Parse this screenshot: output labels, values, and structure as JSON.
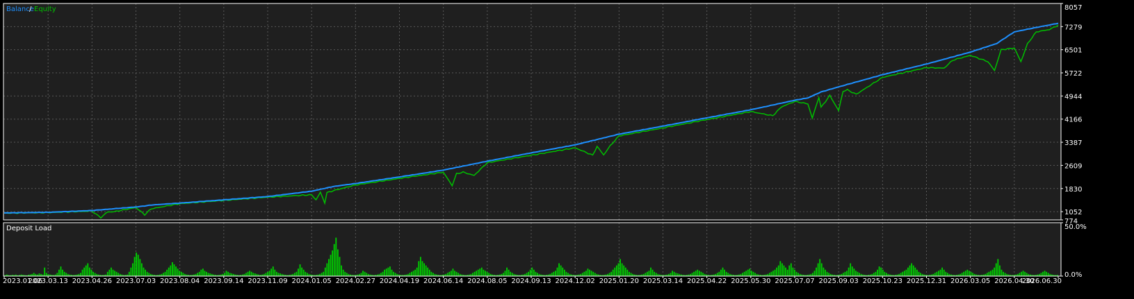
{
  "colors": {
    "background": "#000000",
    "plot_background": "#1f1f1f",
    "grid": "#5a5a5a",
    "frame": "#ffffff",
    "text": "#ffffff",
    "balance": "#1e90ff",
    "equity": "#00c000",
    "deposit_load": "#00d000"
  },
  "legend": {
    "balance": "Balance",
    "separator": "/",
    "equity": "Equity"
  },
  "lower_panel": {
    "title": "Deposit Load"
  },
  "chart_data": [
    {
      "type": "line",
      "name": "balance-equity",
      "ylim": [
        774,
        8057
      ],
      "y_ticks": [
        "8057",
        "7279",
        "6501",
        "5722",
        "4944",
        "4166",
        "3387",
        "2609",
        "1830",
        "1052",
        "774"
      ],
      "x_tick_labels": [
        "2023.01.06",
        "2023.03.13",
        "2023.04.26",
        "2023.07.03",
        "2023.08.04",
        "2023.09.14",
        "2023.11.09",
        "2024.01.05",
        "2024.02.27",
        "2024.04.19",
        "2024.06.14",
        "2024.08.05",
        "2024.09.13",
        "2024.12.02",
        "2025.01.20",
        "2025.03.14",
        "2025.04.22",
        "2025.05.30",
        "2025.07.07",
        "2025.09.03",
        "2025.10.23",
        "2025.12.31",
        "2026.03.05",
        "2026.04.30",
        "2026.06.30"
      ],
      "grid": true,
      "series": [
        {
          "name": "Balance",
          "x": [
            0,
            1,
            2,
            3,
            3.4,
            4,
            5,
            6,
            7,
            7.5,
            8,
            9,
            10,
            11,
            12,
            13,
            14,
            15,
            16,
            17,
            18,
            18.3,
            18.6,
            19,
            20,
            21,
            22,
            22.6,
            23,
            23.5,
            24
          ],
          "values": [
            1010,
            1030,
            1090,
            1210,
            1280,
            1340,
            1450,
            1560,
            1740,
            1900,
            2000,
            2220,
            2450,
            2750,
            3030,
            3300,
            3660,
            3930,
            4210,
            4480,
            4800,
            4880,
            5080,
            5250,
            5660,
            6020,
            6420,
            6710,
            7100,
            7250,
            7390
          ]
        },
        {
          "name": "Equity",
          "x": [
            0,
            1,
            2,
            2.2,
            2.35,
            2.5,
            3,
            3.2,
            3.35,
            3.5,
            4,
            5,
            6,
            7,
            7.1,
            7.2,
            7.3,
            7.35,
            7.5,
            8,
            9,
            10,
            10.2,
            10.3,
            10.45,
            10.7,
            11,
            12,
            13,
            13.4,
            13.5,
            13.65,
            13.8,
            14,
            15,
            16,
            17,
            17.5,
            17.7,
            18,
            18.3,
            18.4,
            18.55,
            18.6,
            18.8,
            19,
            19.1,
            19.2,
            19.4,
            20,
            21,
            21.4,
            21.6,
            22,
            22.4,
            22.55,
            22.7,
            23,
            23.15,
            23.3,
            23.5,
            23.8,
            24
          ],
          "values": [
            1000,
            1020,
            1070,
            850,
            1040,
            1050,
            1190,
            950,
            1150,
            1190,
            1320,
            1430,
            1540,
            1620,
            1450,
            1700,
            1350,
            1690,
            1760,
            1950,
            2170,
            2380,
            1930,
            2330,
            2380,
            2270,
            2700,
            2950,
            3200,
            2950,
            3250,
            2960,
            3270,
            3600,
            3870,
            4150,
            4420,
            4280,
            4580,
            4760,
            4680,
            4200,
            4900,
            4560,
            4960,
            4450,
            5100,
            5150,
            5000,
            5570,
            5900,
            5880,
            6150,
            6310,
            6100,
            5800,
            6500,
            6560,
            6100,
            6700,
            7100,
            7180,
            7330
          ]
        }
      ]
    },
    {
      "type": "bar",
      "name": "Deposit Load",
      "ylim": [
        0,
        50
      ],
      "y_ticks": [
        "50.0%",
        "0.0%"
      ],
      "values": [
        1,
        1.5,
        1,
        0.8,
        1.2,
        1,
        1.4,
        0.8,
        1.1,
        1.5,
        1.2,
        1,
        0.8,
        1.3,
        1.6,
        2,
        3,
        2,
        1.5,
        2.5,
        2,
        1.5,
        8,
        3,
        2,
        1.5,
        1.2,
        1,
        1.5,
        3,
        6,
        9,
        6,
        4,
        3,
        2,
        1.5,
        1.2,
        1,
        1.2,
        1.5,
        2,
        3,
        6,
        8,
        10,
        12,
        8,
        6,
        4,
        3,
        2,
        1.5,
        1.2,
        1,
        1.2,
        1.5,
        4,
        6,
        8,
        6,
        5,
        4,
        3,
        2,
        1.5,
        1,
        1.2,
        1.5,
        4,
        8,
        12,
        18,
        22,
        20,
        16,
        12,
        8,
        6,
        4,
        3,
        2,
        1.5,
        1.2,
        1,
        1.2,
        1.5,
        2,
        3,
        4,
        6,
        8,
        10,
        13,
        11,
        9,
        7,
        5,
        4,
        3,
        2,
        1.5,
        1.2,
        1,
        1.2,
        1.5,
        2,
        3,
        4,
        6,
        7,
        5,
        4,
        3,
        2.5,
        2,
        1.5,
        1.2,
        1,
        1.2,
        1.5,
        2,
        3,
        5,
        4,
        3,
        2.5,
        2,
        1.5,
        1.2,
        1,
        1.2,
        1.5,
        2,
        3,
        4,
        5,
        4,
        3,
        2.5,
        2,
        1.5,
        1.2,
        1.5,
        2,
        3,
        4,
        5,
        7,
        9,
        6,
        4,
        3,
        2.5,
        2,
        1.5,
        1.2,
        1,
        1.2,
        1.5,
        2,
        3,
        4,
        7,
        11,
        8,
        6,
        4,
        3,
        2,
        1.5,
        1.2,
        1,
        1.2,
        1.5,
        2,
        3,
        4,
        8,
        12,
        16,
        20,
        24,
        30,
        36,
        25,
        18,
        10,
        6,
        4,
        3,
        2,
        1.5,
        1.2,
        1,
        1.2,
        1.5,
        2,
        3,
        5,
        4,
        3,
        2,
        1.5,
        1.2,
        1,
        1.2,
        1.5,
        2,
        3,
        4,
        6,
        7,
        8,
        9,
        6,
        4,
        3,
        2,
        1.5,
        1.2,
        1,
        1.2,
        1.5,
        2,
        3,
        4,
        5,
        6,
        8,
        14,
        18,
        14,
        12,
        10,
        8,
        6,
        4,
        3,
        2,
        1.5,
        1.2,
        1,
        1.2,
        1.5,
        2,
        3,
        4,
        5,
        7,
        5,
        4,
        3,
        2,
        1.5,
        1.2,
        1,
        1.2,
        1.5,
        2,
        3,
        4,
        5,
        6,
        7,
        8,
        6,
        5,
        4,
        3,
        2,
        1.5,
        1.2,
        1,
        1.2,
        1.5,
        2,
        3,
        5,
        8,
        6,
        4,
        3,
        2,
        1.5,
        1.2,
        1,
        1.2,
        1.5,
        2,
        3,
        4,
        6,
        8,
        6,
        4,
        3,
        2,
        1.5,
        1.2,
        1,
        1.2,
        1.5,
        2,
        3,
        4,
        5,
        8,
        12,
        10,
        8,
        6,
        4,
        3,
        2,
        1.5,
        1.2,
        1,
        1.2,
        1.5,
        2,
        3,
        4,
        5,
        7,
        6,
        5,
        4,
        3,
        2,
        1.5,
        1.2,
        1,
        1.2,
        1.5,
        2,
        3,
        4,
        6,
        8,
        10,
        12,
        16,
        12,
        10,
        8,
        6,
        4,
        3,
        2,
        1.5,
        1.2,
        1,
        1.2,
        1.5,
        2,
        3,
        4,
        5,
        8,
        6,
        4,
        3,
        2,
        1.5,
        1.2,
        1,
        1.2,
        1.5,
        2,
        3,
        5,
        4,
        3,
        2.5,
        2,
        1.5,
        1.2,
        1,
        1.2,
        1.5,
        2,
        3,
        4,
        5,
        6,
        5,
        4,
        3,
        2,
        1.5,
        1.2,
        1,
        1.2,
        1.5,
        2,
        3,
        4,
        6,
        8,
        6,
        4,
        3,
        2,
        1.5,
        1.2,
        1,
        1.2,
        1.5,
        2,
        3,
        4,
        5,
        6,
        7,
        5,
        4,
        3,
        2,
        1.5,
        1.2,
        1,
        1.2,
        1.5,
        2,
        3,
        4,
        5,
        6,
        8,
        10,
        14,
        12,
        10,
        8,
        6,
        10,
        12,
        8,
        6,
        4,
        3,
        2,
        1.5,
        1.2,
        1,
        1.2,
        1.5,
        2,
        3,
        5,
        8,
        12,
        16,
        12,
        8,
        6,
        4,
        3,
        2,
        1.5,
        1.2,
        1,
        1.2,
        1.5,
        2,
        3,
        4,
        5,
        8,
        12,
        9,
        7,
        5,
        4,
        3,
        2,
        1.5,
        1.2,
        1,
        1.2,
        1.5,
        2,
        3,
        4,
        6,
        9,
        8,
        6,
        4,
        3,
        2,
        1.5,
        1.2,
        1,
        1.2,
        1.5,
        2,
        3,
        4,
        5,
        6,
        8,
        10,
        12,
        10,
        8,
        6,
        4,
        3,
        2,
        1.5,
        1.2,
        1,
        1.2,
        1.5,
        2,
        3,
        4,
        5,
        6,
        8,
        6,
        4,
        3,
        2,
        1.5,
        1.2,
        1,
        1.2,
        1.5,
        2,
        3,
        4,
        5,
        6,
        5,
        4,
        3,
        2,
        1.5,
        1.2,
        1,
        1.2,
        1.5,
        2,
        3,
        4,
        5,
        6,
        8,
        12,
        16,
        10,
        6,
        4,
        3,
        2,
        1.5,
        1.2,
        1,
        1.2,
        1.5,
        2,
        3,
        4,
        5,
        4,
        3,
        2,
        1.5,
        1.2,
        1,
        1.2,
        1.5,
        2,
        3,
        4,
        5,
        4,
        3,
        2,
        1.5,
        1.2,
        1,
        1.2
      ]
    }
  ]
}
